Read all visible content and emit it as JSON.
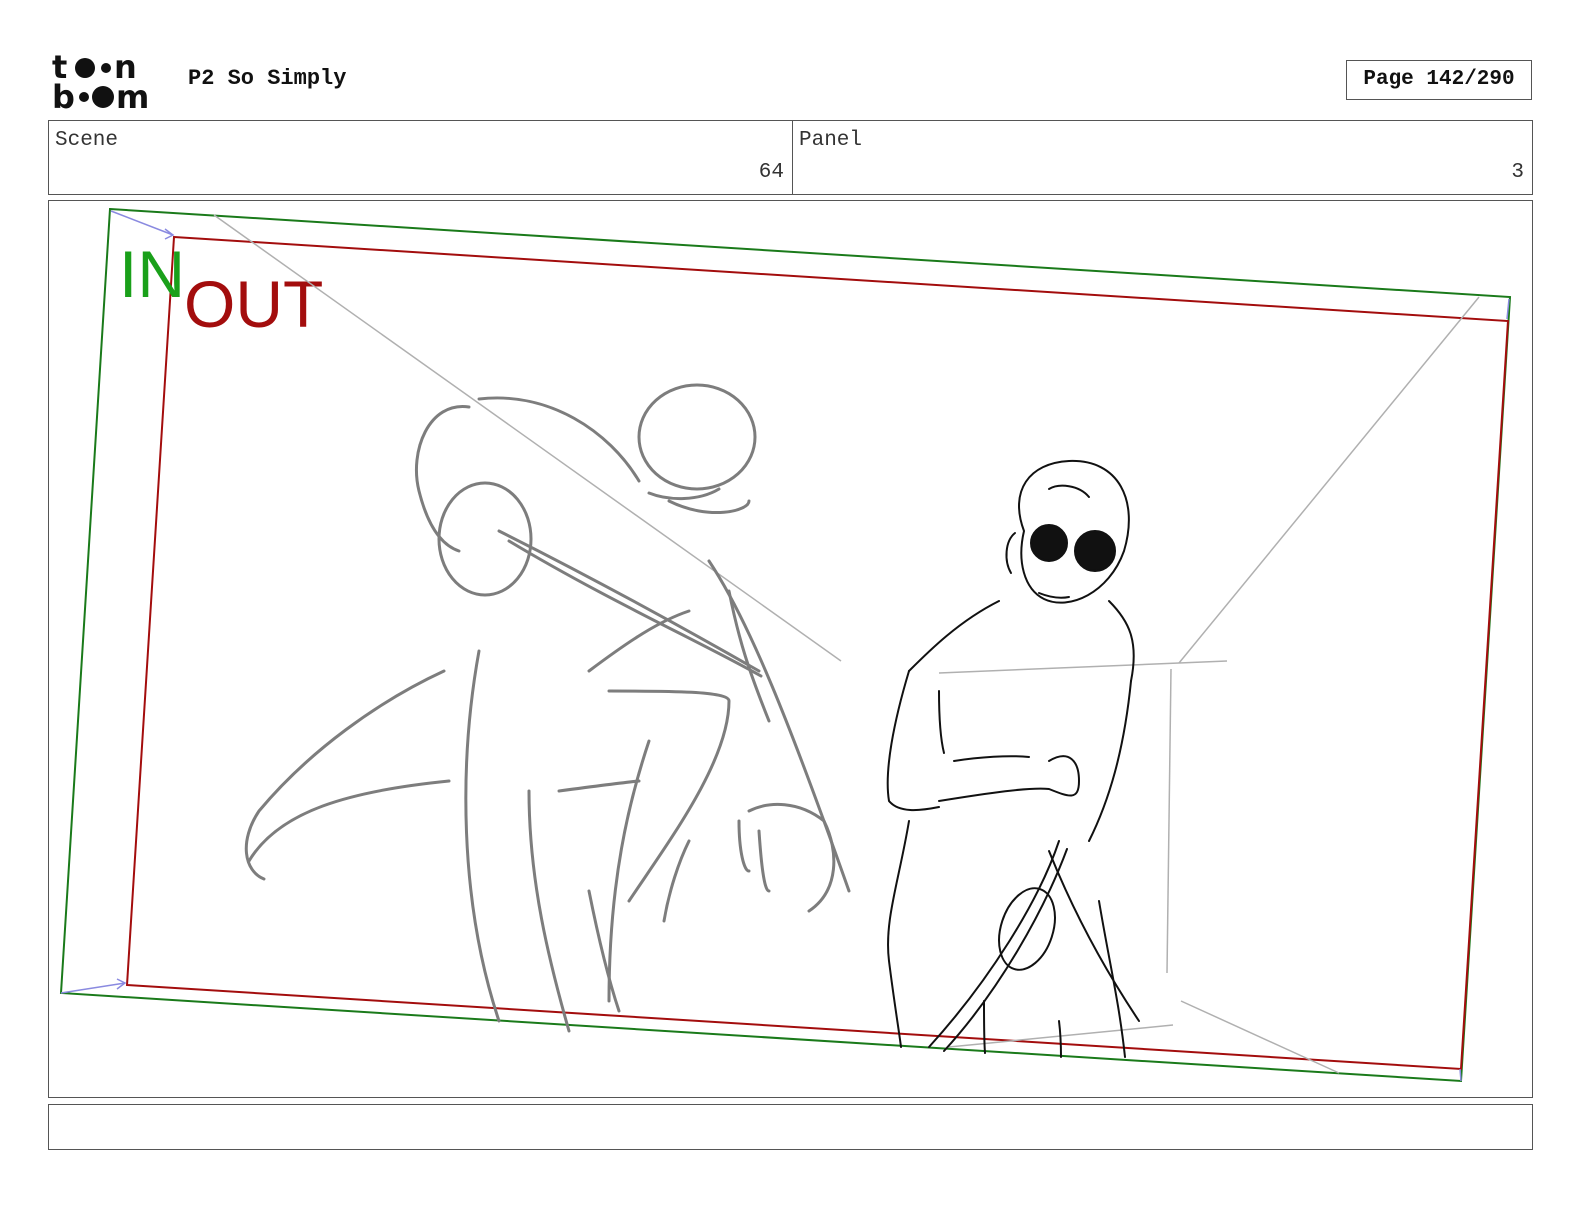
{
  "header": {
    "logo_text_top": "toon",
    "logo_text_bottom": "boom",
    "project_title": "P2 So Simply",
    "page_label": "Page 142/290"
  },
  "info": {
    "scene_label": "Scene",
    "scene_value": "64",
    "panel_label": "Panel",
    "panel_value": "3"
  },
  "panel_frame": {
    "in_marker": "IN",
    "out_marker": "OUT",
    "in_color": "#1aa01a",
    "out_color": "#a30d0d"
  },
  "notes": {
    "text": ""
  }
}
